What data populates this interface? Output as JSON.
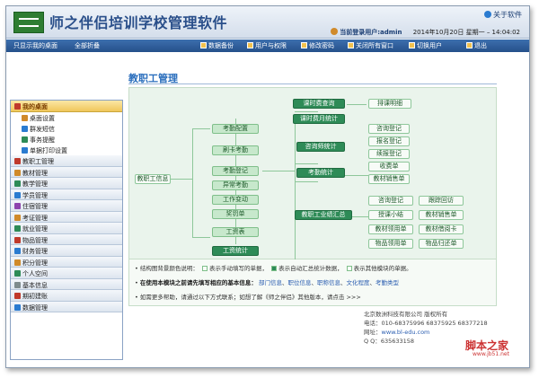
{
  "app": {
    "title": "师之伴侣培训学校管理软件",
    "about": "关于软件",
    "current_user": "当前登录用户:admin",
    "date": "2014年10月20日",
    "weekday": "星期一",
    "time": "14:04:02"
  },
  "toolbar": {
    "show_desktop": "只显示我的桌面",
    "collapse_all": "全部折叠",
    "backup": "数据备份",
    "users_perms": "用户与权限",
    "change_password": "修改密码",
    "close_windows": "关闭所有窗口",
    "switch_user": "切换用户",
    "exit": "退出"
  },
  "sidebar": {
    "desktop_header": "我的桌面",
    "desktop_items": [
      {
        "label": "桌面设置",
        "color": "#d08a2a"
      },
      {
        "label": "群发短信",
        "color": "#2a7bd0"
      },
      {
        "label": "事务提醒",
        "color": "#2e8b57"
      },
      {
        "label": "单据打印设置",
        "color": "#2a7bd0"
      }
    ],
    "modules": [
      {
        "label": "教职工管理",
        "color": "#c0392b"
      },
      {
        "label": "教材管理",
        "color": "#d08a2a"
      },
      {
        "label": "教学管理",
        "color": "#2e8b57"
      },
      {
        "label": "学员管理",
        "color": "#2a7bd0"
      },
      {
        "label": "住宿管理",
        "color": "#8e44ad"
      },
      {
        "label": "考证管理",
        "color": "#d08a2a"
      },
      {
        "label": "就业管理",
        "color": "#2e8b57"
      },
      {
        "label": "物品管理",
        "color": "#c0392b"
      },
      {
        "label": "财务管理",
        "color": "#2a7bd0"
      },
      {
        "label": "积分管理",
        "color": "#d08a2a"
      },
      {
        "label": "个人空间",
        "color": "#2e8b57"
      },
      {
        "label": "基本信息",
        "color": "#7f8c8d"
      },
      {
        "label": "期初建账",
        "color": "#c0392b"
      },
      {
        "label": "数据管理",
        "color": "#2a7bd0"
      }
    ]
  },
  "module_title": "教职工管理",
  "diagram": {
    "staff_info": "教职工信息",
    "attendance_config": "考勤配置",
    "card_attendance": "刷卡考勤",
    "attendance_register": "考勤登记",
    "abnormal_attendance": "异常考勤",
    "work_change": "工作变动",
    "reward_punish": "奖罚单",
    "salary_sheet": "工资表",
    "salary_stats": "工资统计",
    "class_fee_query": "课时费查询",
    "class_fee_monthly": "课时费月统计",
    "schedule_detail": "排课明细",
    "counselor_stats": "咨询师统计",
    "attendance_stats": "考勤统计",
    "counselor_items": [
      "咨询登记",
      "报名登记",
      "续报登记",
      "收费单",
      "教材销售单"
    ],
    "staff_summary": "教职工业绩汇总",
    "summary_items": [
      "咨询登记",
      "跟踪回访",
      "授课小结",
      "教材销售单",
      "教材领用单",
      "教材借阅卡",
      "物品领用单",
      "物品归还单"
    ]
  },
  "legend": {
    "color_note": "结构图背景颜色说明：",
    "manual_label": "表示手动填写的单据，",
    "auto_label": "表示自动汇总统计数据，",
    "other_label": "表示其他模块的单据。",
    "prereq_label": "在使用本模块之前请先填写相应的基本信息：",
    "prereq_links": [
      "部门信息",
      "职位信息",
      "职称信息",
      "文化程度",
      "考勤类型"
    ],
    "help_text": "如需更多帮助，请通过以下方式联系；如想了解《师之伴侣》其他版本，请点击 >>>"
  },
  "footer": {
    "company": "北京数洲科技有限公司 版权所有",
    "phone_label": "电话：",
    "phone": "010-68375996  68375925  68377218",
    "web_label": "网址：",
    "web": "www.bl-edu.com",
    "qq_label": "Q Q：",
    "qq": "635633158"
  },
  "watermark": {
    "text": "脚本之家",
    "url": "www.jb51.net"
  }
}
